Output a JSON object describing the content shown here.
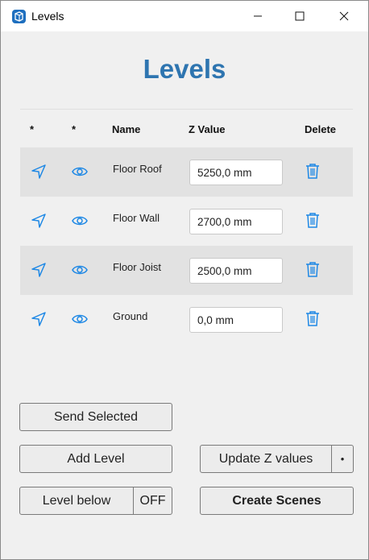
{
  "window": {
    "title": "Levels"
  },
  "heading": "Levels",
  "table": {
    "headers": {
      "nav": "*",
      "visibility": "*",
      "name": "Name",
      "z": "Z Value",
      "delete": "Delete"
    },
    "rows": [
      {
        "name": "Floor Roof",
        "z": "5250,0 mm"
      },
      {
        "name": "Floor Wall",
        "z": "2700,0 mm"
      },
      {
        "name": "Floor Joist",
        "z": "2500,0 mm"
      },
      {
        "name": "Ground",
        "z": "0,0 mm"
      }
    ]
  },
  "buttons": {
    "send_selected": "Send Selected",
    "add_level": "Add Level",
    "update_z": "Update Z values",
    "update_z_more": "•",
    "level_below": "Level below",
    "level_below_state": "OFF",
    "create_scenes": "Create Scenes"
  },
  "colors": {
    "accent": "#2e75b0",
    "icon": "#1e88e5",
    "row_shaded": "#e2e2e2"
  }
}
